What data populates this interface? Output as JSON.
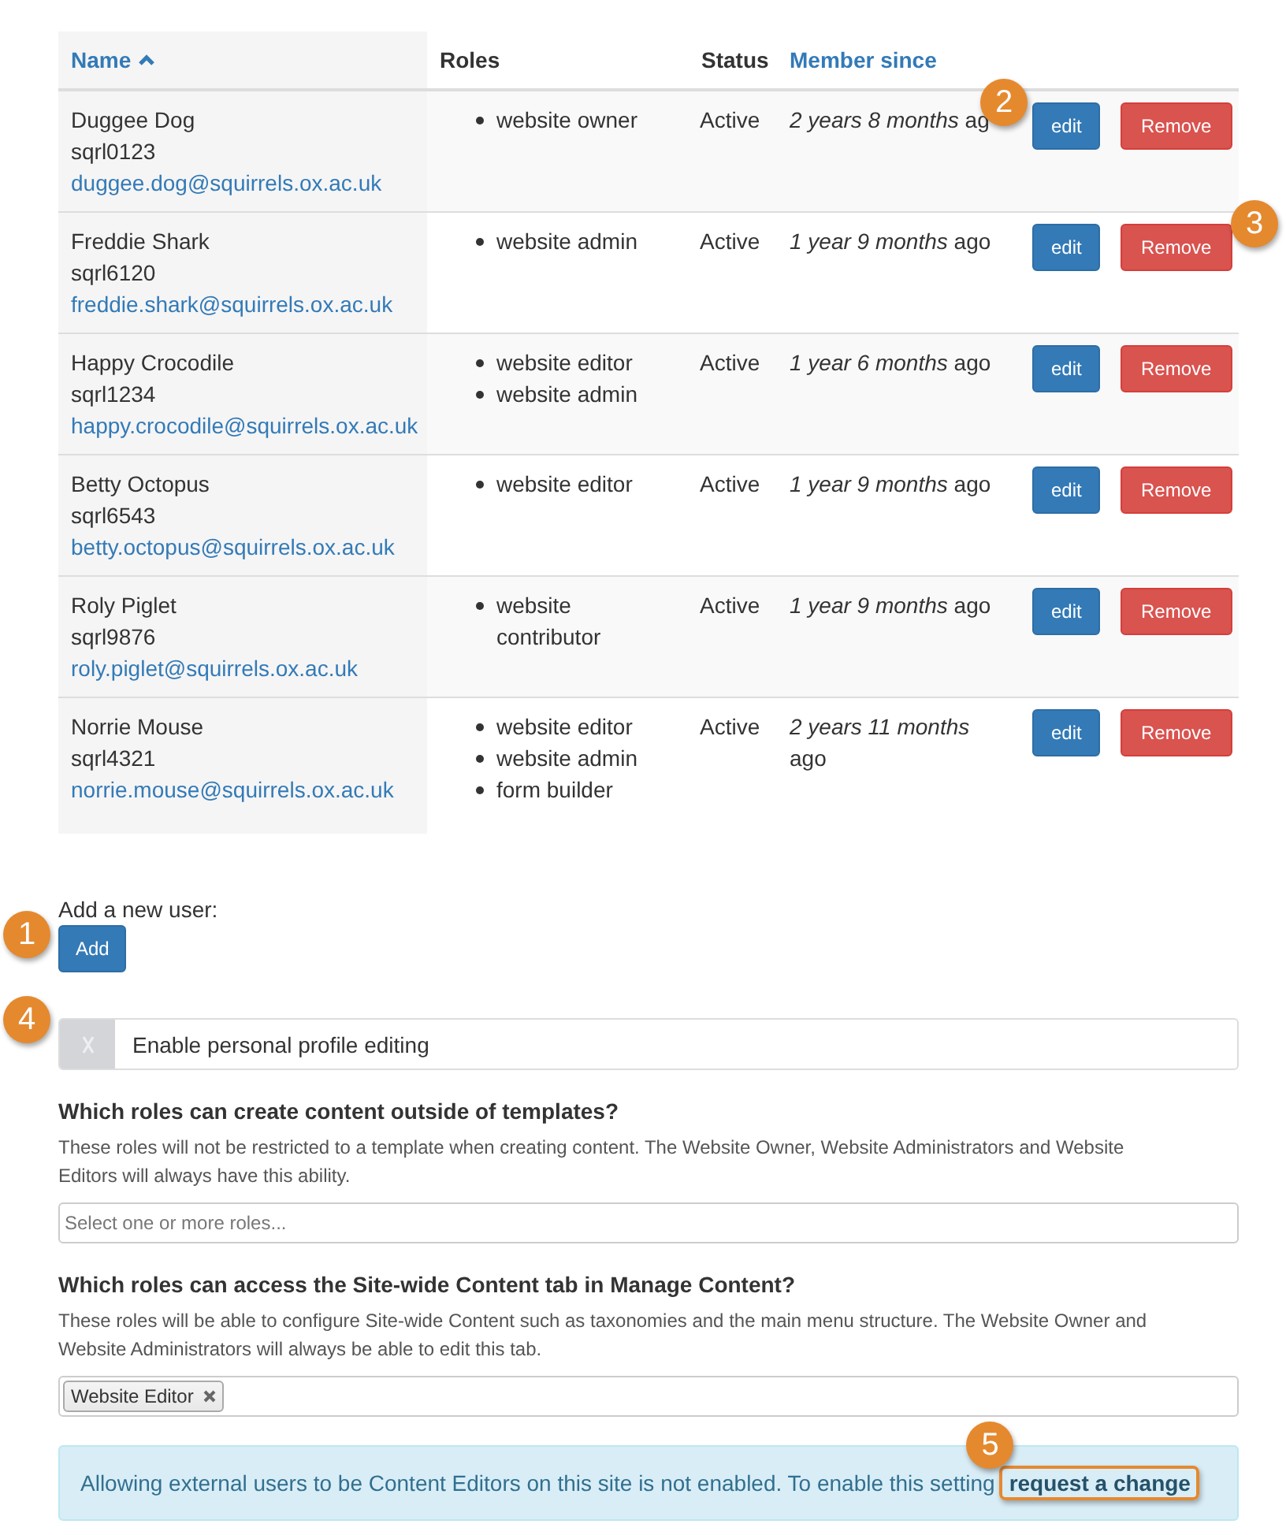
{
  "table": {
    "columns": [
      {
        "label": "Name",
        "sortable": true,
        "sorted": true
      },
      {
        "label": "Roles",
        "sortable": false,
        "sorted": false
      },
      {
        "label": "Status",
        "sortable": false,
        "sorted": false
      },
      {
        "label": "Member since",
        "sortable": true,
        "sorted": false
      }
    ],
    "rows": [
      {
        "name": "Duggee Dog",
        "username": "sqrl0123",
        "email": "duggee.dog@squirrels.ox.ac.uk",
        "roles": [
          "website owner"
        ],
        "status": "Active",
        "member_since": "*2 years 8 months* ag",
        "edit": "edit",
        "remove": "Remove",
        "edit_callout": "2"
      },
      {
        "name": "Freddie Shark",
        "username": "sqrl6120",
        "email": "freddie.shark@squirrels.ox.ac.uk",
        "roles": [
          "website admin"
        ],
        "status": "Active",
        "member_since": "*1 year 9 months* ago",
        "edit": "edit",
        "remove": "Remove",
        "remove_callout": "3"
      },
      {
        "name": "Happy Crocodile",
        "username": "sqrl1234",
        "email": "happy.crocodile@squirrels.ox.ac.uk",
        "roles": [
          "website editor",
          "website admin"
        ],
        "status": "Active",
        "member_since": "*1 year 6 months* ago",
        "edit": "edit",
        "remove": "Remove"
      },
      {
        "name": "Betty Octopus",
        "username": "sqrl6543",
        "email": "betty.octopus@squirrels.ox.ac.uk",
        "roles": [
          "website editor"
        ],
        "status": "Active",
        "member_since": "*1 year 9 months* ago",
        "edit": "edit",
        "remove": "Remove"
      },
      {
        "name": "Roly Piglet",
        "username": "sqrl9876",
        "email": "roly.piglet@squirrels.ox.ac.uk",
        "roles": [
          "website contributor"
        ],
        "status": "Active",
        "member_since": "*1 year 9 months* ago",
        "edit": "edit",
        "remove": "Remove"
      },
      {
        "name": "Norrie Mouse",
        "username": "sqrl4321",
        "email": "norrie.mouse@squirrels.ox.ac.uk",
        "roles": [
          "website editor",
          "website admin",
          "form builder"
        ],
        "status": "Active",
        "member_since": "*2 years 11 months* ago",
        "edit": "edit",
        "remove": "Remove"
      }
    ]
  },
  "add_user": {
    "label": "Add a new user:",
    "button": "Add",
    "callout": "1"
  },
  "profile_editing": {
    "label": "Enable personal profile editing",
    "on": false,
    "callout": "4"
  },
  "settings": [
    {
      "heading": "Which roles can create content outside of templates?",
      "help": "These roles will not be restricted to a template when creating content. The Website Owner, Website Administrators and Website Editors will always have this ability.",
      "placeholder": "Select one or more roles..."
    },
    {
      "heading": "Which roles can access the Site-wide Content tab in Manage Content?",
      "help": "These roles will be able to configure Site-wide Content such as taxonomies and the main menu structure. The Website Owner and Website Administrators will always be able to edit this tab.",
      "tags": [
        "Website Editor"
      ]
    }
  ],
  "notice": {
    "text": "Allowing external users to be Content Editors on this site is not enabled. To enable this setting",
    "action": {
      "label": "request a change",
      "highlighted": true,
      "callout": "5"
    }
  }
}
